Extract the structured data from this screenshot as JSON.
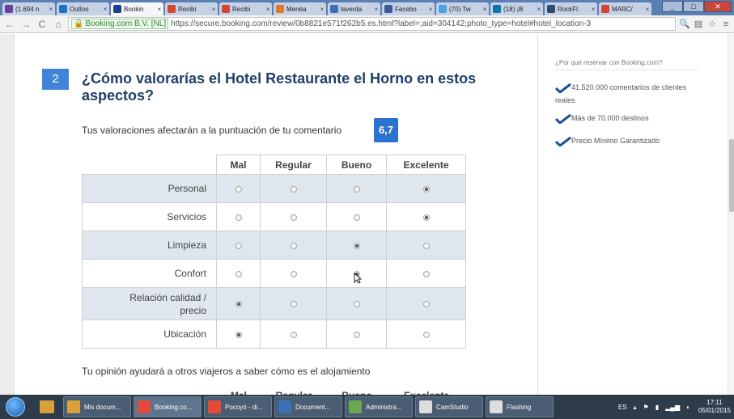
{
  "browser": {
    "tabs": [
      {
        "title": "(1.694 n",
        "icon_color": "#6b3fa0",
        "icon": "mail-icon"
      },
      {
        "title": "Outloo",
        "icon_color": "#1e72c4",
        "icon": "outlook-icon"
      },
      {
        "title": "Bookin",
        "icon_color": "#1d3f8f",
        "icon": "booking-icon",
        "active": true
      },
      {
        "title": "Recibi",
        "icon_color": "#d64432",
        "icon": "gmail-icon"
      },
      {
        "title": "Recibi",
        "icon_color": "#d64432",
        "icon": "gmail-icon"
      },
      {
        "title": "Menéa",
        "icon_color": "#e07a2b",
        "icon": "meneame-icon"
      },
      {
        "title": "laverda",
        "icon_color": "#3c6fb6",
        "icon": "lv-icon"
      },
      {
        "title": "Facebo",
        "icon_color": "#3b5998",
        "icon": "facebook-icon"
      },
      {
        "title": "(70) Tw",
        "icon_color": "#4aa3df",
        "icon": "twitter-icon"
      },
      {
        "title": "(18) ¡B",
        "icon_color": "#0e76a8",
        "icon": "linkedin-icon"
      },
      {
        "title": "RockFl",
        "icon_color": "#2b4d6e",
        "icon": "rockfl-icon"
      },
      {
        "title": "MARC/",
        "icon_color": "#d64432",
        "icon": "gmail-icon"
      }
    ],
    "secure_label": "Booking.com B.V. [NL]",
    "url": "https://secure.booking.com/review/0b8821e571f262b5.es.html?label=;aid=304142;photo_type=hotel#hotel_location-3"
  },
  "review": {
    "step_number": "2",
    "question": "¿Cómo valorarías el Hotel Restaurante el Horno en estos aspectos?",
    "note": "Tus valoraciones afectarán a la puntuación de tu comentario",
    "score": "6,7",
    "columns": [
      "Mal",
      "Regular",
      "Bueno",
      "Excelente"
    ],
    "rows": [
      {
        "label": "Personal",
        "selected": 3
      },
      {
        "label": "Servicios",
        "selected": 3
      },
      {
        "label": "Limpieza",
        "selected": 2
      },
      {
        "label": "Confort",
        "selected": 2
      },
      {
        "label": "Relación calidad / precio",
        "selected": 0
      },
      {
        "label": "Ubicación",
        "selected": 0
      }
    ],
    "opinion_text": "Tu opinión ayudará a otros viajeros a saber cómo es el alojamiento"
  },
  "sidebar": {
    "title": "¿Por qué reservar con Booking.com?",
    "items": [
      "41.520.000 comentarios de clientes reales",
      "Más de 70.000 destinos",
      "Precio Mínimo Garantizado"
    ]
  },
  "taskbar": {
    "tasks": [
      {
        "label": "Mis docum...",
        "icon_color": "#d9a13a"
      },
      {
        "label": "Booking.co...",
        "icon_color": "#e34a3b",
        "active": true
      },
      {
        "label": "Pocoyó - di...",
        "icon_color": "#e34a3b"
      },
      {
        "label": "Document...",
        "icon_color": "#3b6fb6"
      },
      {
        "label": "Administra...",
        "icon_color": "#6aa84f"
      },
      {
        "label": "CamStudio",
        "icon_color": "#dddddd"
      },
      {
        "label": "Flashing",
        "icon_color": "#dddddd"
      }
    ],
    "language": "ES",
    "time": "17:11",
    "date": "05/01/2015"
  }
}
